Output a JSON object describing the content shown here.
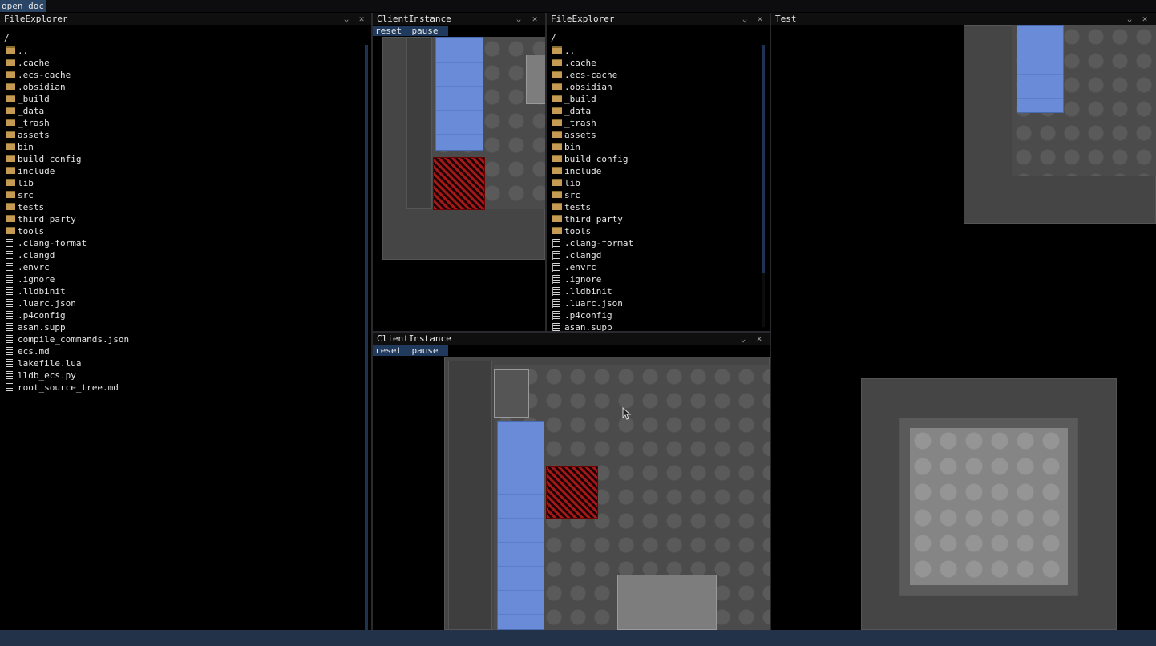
{
  "menu": {
    "open_doc": "open doc"
  },
  "file_explorer_left": {
    "title": "FileExplorer",
    "path": "/",
    "folders": [
      "..",
      ".cache",
      ".ecs-cache",
      ".obsidian",
      "_build",
      "_data",
      "_trash",
      "assets",
      "bin",
      "build_config",
      "include",
      "lib",
      "src",
      "tests",
      "third_party",
      "tools"
    ],
    "files": [
      ".clang-format",
      ".clangd",
      ".envrc",
      ".ignore",
      ".lldbinit",
      ".luarc.json",
      ".p4config",
      "asan.supp",
      "compile_commands.json",
      "ecs.md",
      "lakefile.lua",
      "lldb_ecs.py",
      "root_source_tree.md"
    ]
  },
  "client_top": {
    "title": "ClientInstance",
    "reset": "reset",
    "pause": "pause"
  },
  "file_explorer_right": {
    "title": "FileExplorer",
    "path": "/",
    "folders": [
      "..",
      ".cache",
      ".ecs-cache",
      ".obsidian",
      "_build",
      "_data",
      "_trash",
      "assets",
      "bin",
      "build_config",
      "include",
      "lib",
      "src",
      "tests",
      "third_party",
      "tools"
    ],
    "files": [
      ".clang-format",
      ".clangd",
      ".envrc",
      ".ignore",
      ".lldbinit",
      ".luarc.json",
      ".p4config",
      "asan.supp"
    ]
  },
  "client_bottom": {
    "title": "ClientInstance",
    "reset": "reset",
    "pause": "pause"
  },
  "test_panel": {
    "title": "Test"
  },
  "icons": {
    "collapse": "chevron-down-icon",
    "close": "close-icon",
    "folder": "folder-icon",
    "file": "file-icon",
    "cursor": "mouse-cursor-icon"
  },
  "colors": {
    "accent": "#2a4566",
    "status_bar": "#223349",
    "bed": "#6a8cd8",
    "hazard": "#a01818"
  }
}
